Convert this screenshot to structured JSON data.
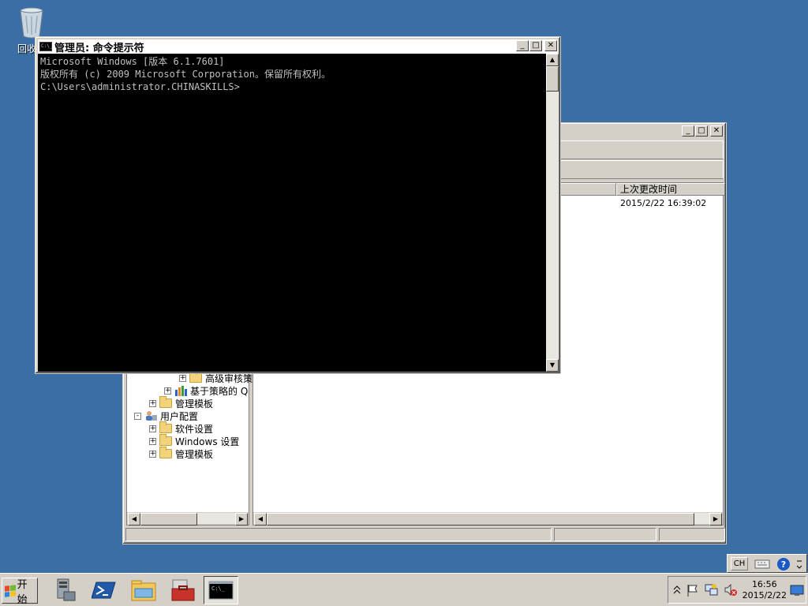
{
  "desktop": {
    "recycle_bin_label": "回收站"
  },
  "mmc": {
    "buttons": {
      "minimize": "_",
      "maximize": "□",
      "close": "✕"
    },
    "column_last_modified": "上次更改时间",
    "row_timestamp": "2015/2/22 16:39:02",
    "tree": [
      {
        "label": "高级审核策",
        "indent": 2,
        "expander": "+"
      },
      {
        "label": "基于策略的 Q",
        "indent": 1,
        "expander": "+"
      },
      {
        "label": "管理模板",
        "indent": 0,
        "expander": "+"
      },
      {
        "label": "用户配置",
        "indent": -1,
        "expander": "-"
      },
      {
        "label": "软件设置",
        "indent": 0,
        "expander": "+"
      },
      {
        "label": "Windows 设置",
        "indent": 0,
        "expander": "+"
      },
      {
        "label": "管理模板",
        "indent": 0,
        "expander": "+"
      }
    ]
  },
  "cmd": {
    "icon_text": "C:\\_",
    "title": "管理员: 命令提示符",
    "buttons": {
      "minimize": "_",
      "maximize": "□",
      "close": "✕"
    },
    "lines": [
      "Microsoft Windows [版本 6.1.7601]",
      "版权所有 (c) 2009 Microsoft Corporation。保留所有权利。",
      "",
      "C:\\Users\\administrator.CHINASKILLS>"
    ]
  },
  "taskbar": {
    "start_label": "开始",
    "language": "CH",
    "clock_time": "16:56",
    "clock_date": "2015/2/22",
    "pinned": [
      {
        "name": "server-manager-icon"
      },
      {
        "name": "powershell-icon"
      },
      {
        "name": "explorer-icon"
      },
      {
        "name": "toolbox-icon"
      },
      {
        "name": "cmd-taskbar-icon"
      }
    ]
  },
  "colors": {
    "desktop": "#3a6ea5",
    "window_face": "#d4d0c8",
    "console_bg": "#000000",
    "console_text": "#c0c0c0"
  }
}
